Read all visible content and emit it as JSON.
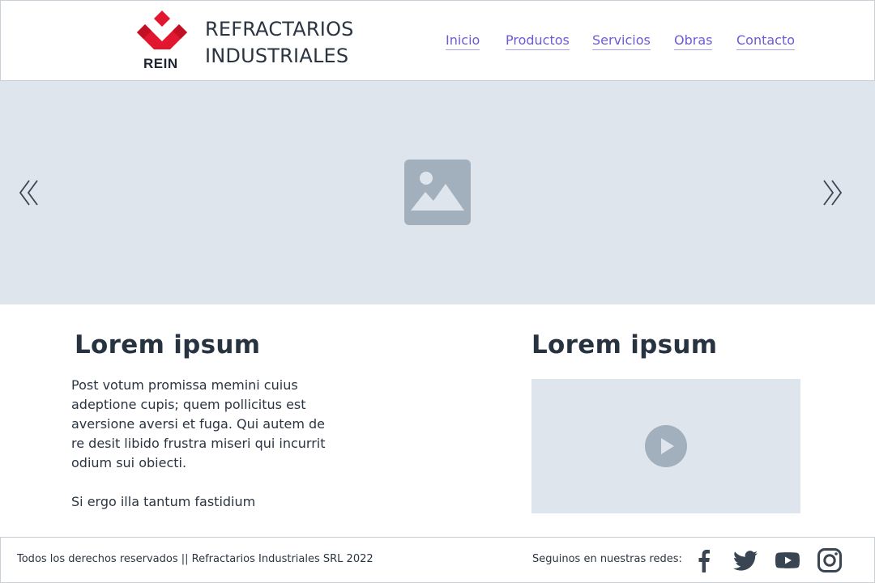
{
  "header": {
    "logo_text": "REIN",
    "brand_line1": "REFRACTARIOS",
    "brand_line2": "INDUSTRIALES",
    "nav": [
      "Inicio",
      "Productos",
      "Servicios",
      "Obras",
      "Contacto"
    ]
  },
  "hero": {
    "image_icon": "image-placeholder-icon",
    "prev_icon": "chevron-double-left-icon",
    "next_icon": "chevron-double-right-icon"
  },
  "content": {
    "left_title": "Lorem ipsum",
    "left_paragraph_1": "Post votum promissa memini cuius adeptione cupis; quem pollicitus est aversione aversi et fuga. Qui autem de re desit libido frustra miseri qui incurrit odium sui obiecti.",
    "left_paragraph_2": "Si ergo illa tantum fastidium",
    "right_title": "Lorem ipsum",
    "video_icon": "play-icon"
  },
  "footer": {
    "copyright": "Todos los derechos reservados || Refractarios Industriales SRL 2022",
    "social_label": "Seguinos en nuestras redes:",
    "social": [
      "facebook-icon",
      "twitter-icon",
      "youtube-icon",
      "instagram-icon"
    ]
  },
  "colors": {
    "brand_red": "#e2162e",
    "nav_link": "#6b5bd6",
    "placeholder_bg": "#dfe5ed",
    "placeholder_icon": "#a2b0bd",
    "text": "#2b3441"
  }
}
